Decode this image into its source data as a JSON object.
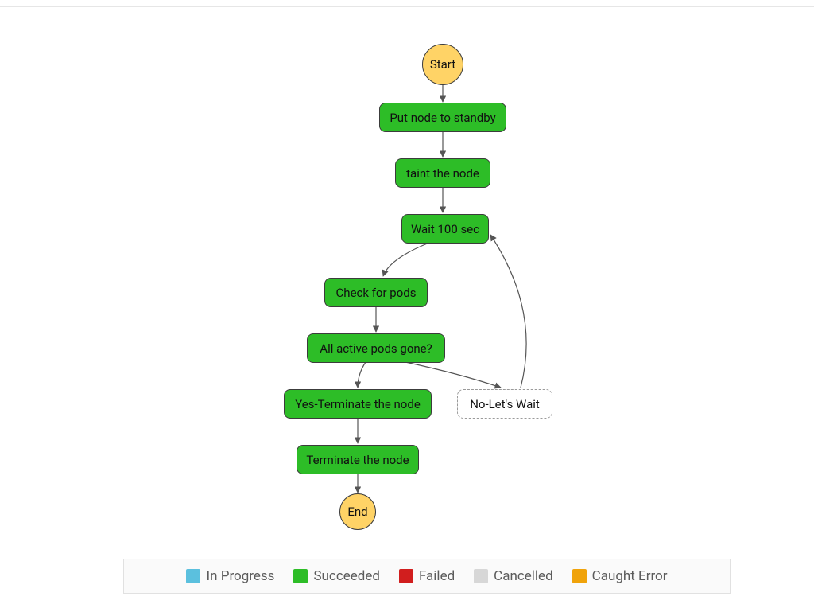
{
  "chart_data": {
    "type": "flowchart",
    "nodes": [
      {
        "id": "start",
        "label": "Start",
        "shape": "circle",
        "state": "terminal"
      },
      {
        "id": "standby",
        "label": "Put node to standby",
        "shape": "rect",
        "state": "succeeded"
      },
      {
        "id": "taint",
        "label": "taint the node",
        "shape": "rect",
        "state": "succeeded"
      },
      {
        "id": "wait",
        "label": "Wait 100 sec",
        "shape": "rect",
        "state": "succeeded"
      },
      {
        "id": "check",
        "label": "Check for pods",
        "shape": "rect",
        "state": "succeeded"
      },
      {
        "id": "choice",
        "label": "All active pods gone?",
        "shape": "rect",
        "state": "succeeded"
      },
      {
        "id": "yes",
        "label": "Yes-Terminate the node",
        "shape": "rect",
        "state": "succeeded"
      },
      {
        "id": "no",
        "label": "No-Let's Wait",
        "shape": "rect",
        "state": "unvisited"
      },
      {
        "id": "terminate",
        "label": "Terminate the node",
        "shape": "rect",
        "state": "succeeded"
      },
      {
        "id": "end",
        "label": "End",
        "shape": "circle",
        "state": "terminal"
      }
    ],
    "edges": [
      {
        "from": "start",
        "to": "standby"
      },
      {
        "from": "standby",
        "to": "taint"
      },
      {
        "from": "taint",
        "to": "wait"
      },
      {
        "from": "wait",
        "to": "check"
      },
      {
        "from": "check",
        "to": "choice"
      },
      {
        "from": "choice",
        "to": "yes"
      },
      {
        "from": "choice",
        "to": "no"
      },
      {
        "from": "yes",
        "to": "terminate"
      },
      {
        "from": "terminate",
        "to": "end"
      },
      {
        "from": "no",
        "to": "wait"
      }
    ]
  },
  "legend": {
    "items": [
      {
        "label": "In Progress",
        "color": "#5bc0de"
      },
      {
        "label": "Succeeded",
        "color": "#2dbd27"
      },
      {
        "label": "Failed",
        "color": "#d11e1e"
      },
      {
        "label": "Cancelled",
        "color": "#d7d7d7"
      },
      {
        "label": "Caught Error",
        "color": "#f0a30a"
      }
    ]
  }
}
